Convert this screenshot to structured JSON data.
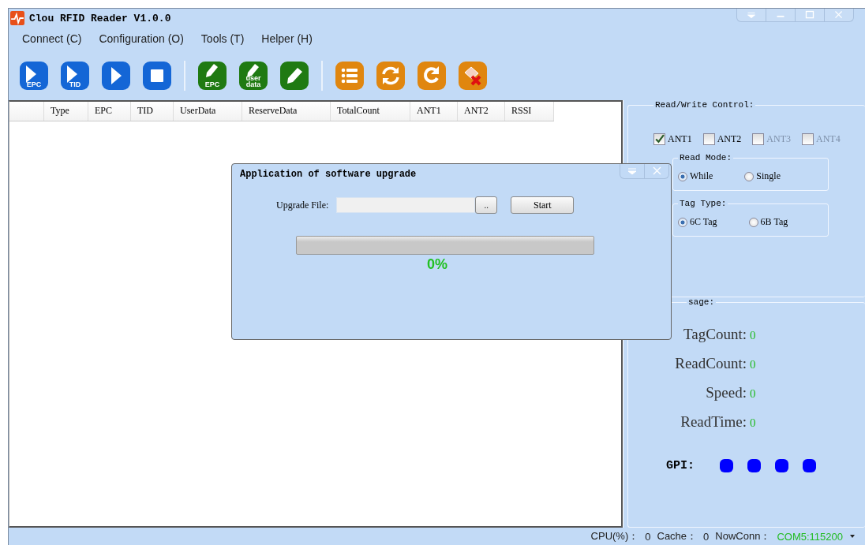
{
  "window": {
    "title": "Clou RFID Reader V1.0.0"
  },
  "menu": [
    "Connect (C)",
    "Configuration (O)",
    "Tools (T)",
    "Helper (H)"
  ],
  "toolbar": [
    [
      {
        "kind": "play",
        "color": "#1466d6",
        "label": "EPC"
      },
      {
        "kind": "play",
        "color": "#1466d6",
        "label": "TID"
      },
      {
        "kind": "play",
        "color": "#1466d6"
      },
      {
        "kind": "stop",
        "color": "#1466d6"
      }
    ],
    [
      {
        "kind": "edit",
        "color": "#1f7a12",
        "label": "EPC"
      },
      {
        "kind": "edit",
        "color": "#1f7a12",
        "label": "user data"
      },
      {
        "kind": "edit",
        "color": "#1f7a12"
      }
    ],
    [
      {
        "kind": "list",
        "color": "#e0860f"
      },
      {
        "kind": "refresh",
        "color": "#e0860f"
      },
      {
        "kind": "redo",
        "color": "#e0860f"
      },
      {
        "kind": "clear",
        "color": "#e0860f"
      }
    ]
  ],
  "table": {
    "columns": [
      "",
      "Type",
      "EPC",
      "TID",
      "UserData",
      "ReserveData",
      "TotalCount",
      "ANT1",
      "ANT2",
      "RSSI"
    ]
  },
  "control": {
    "title": "Read/Write Control:",
    "antennas": [
      {
        "label": "ANT1",
        "checked": true,
        "disabled": false
      },
      {
        "label": "ANT2",
        "checked": false,
        "disabled": false
      },
      {
        "label": "ANT3",
        "checked": false,
        "disabled": true
      },
      {
        "label": "ANT4",
        "checked": false,
        "disabled": true
      }
    ],
    "read_mode": {
      "title": "Read Mode:",
      "options": [
        {
          "label": "While",
          "selected": true
        },
        {
          "label": "Single",
          "selected": false
        }
      ]
    },
    "tag_type": {
      "title": "Tag Type:",
      "options": [
        {
          "label": "6C Tag",
          "selected": true
        },
        {
          "label": "6B Tag",
          "selected": false
        }
      ]
    }
  },
  "message": {
    "title": "sage:",
    "stats": [
      {
        "label": "TagCount:",
        "value": "0"
      },
      {
        "label": "ReadCount:",
        "value": "0"
      },
      {
        "label": "Speed:",
        "value": "0"
      },
      {
        "label": "ReadTime:",
        "value": "0"
      }
    ],
    "gpi_label": "GPI:",
    "gpi": [
      {
        "color": "#0000ff"
      },
      {
        "color": "#0000ff"
      },
      {
        "color": "#0000ff"
      },
      {
        "color": "#0000ff"
      }
    ]
  },
  "status_bar": {
    "cpu_label": "CPU(%)：",
    "cpu": "0",
    "cache_label": "Cache：",
    "cache": "0",
    "conn_label": "NowConn：",
    "conn": "COM5:115200"
  },
  "dialog": {
    "title": "Application of software upgrade",
    "file_label": "Upgrade File:",
    "browse": "..",
    "start": "Start",
    "progress": {
      "level": 0
    },
    "percent": "0%"
  }
}
